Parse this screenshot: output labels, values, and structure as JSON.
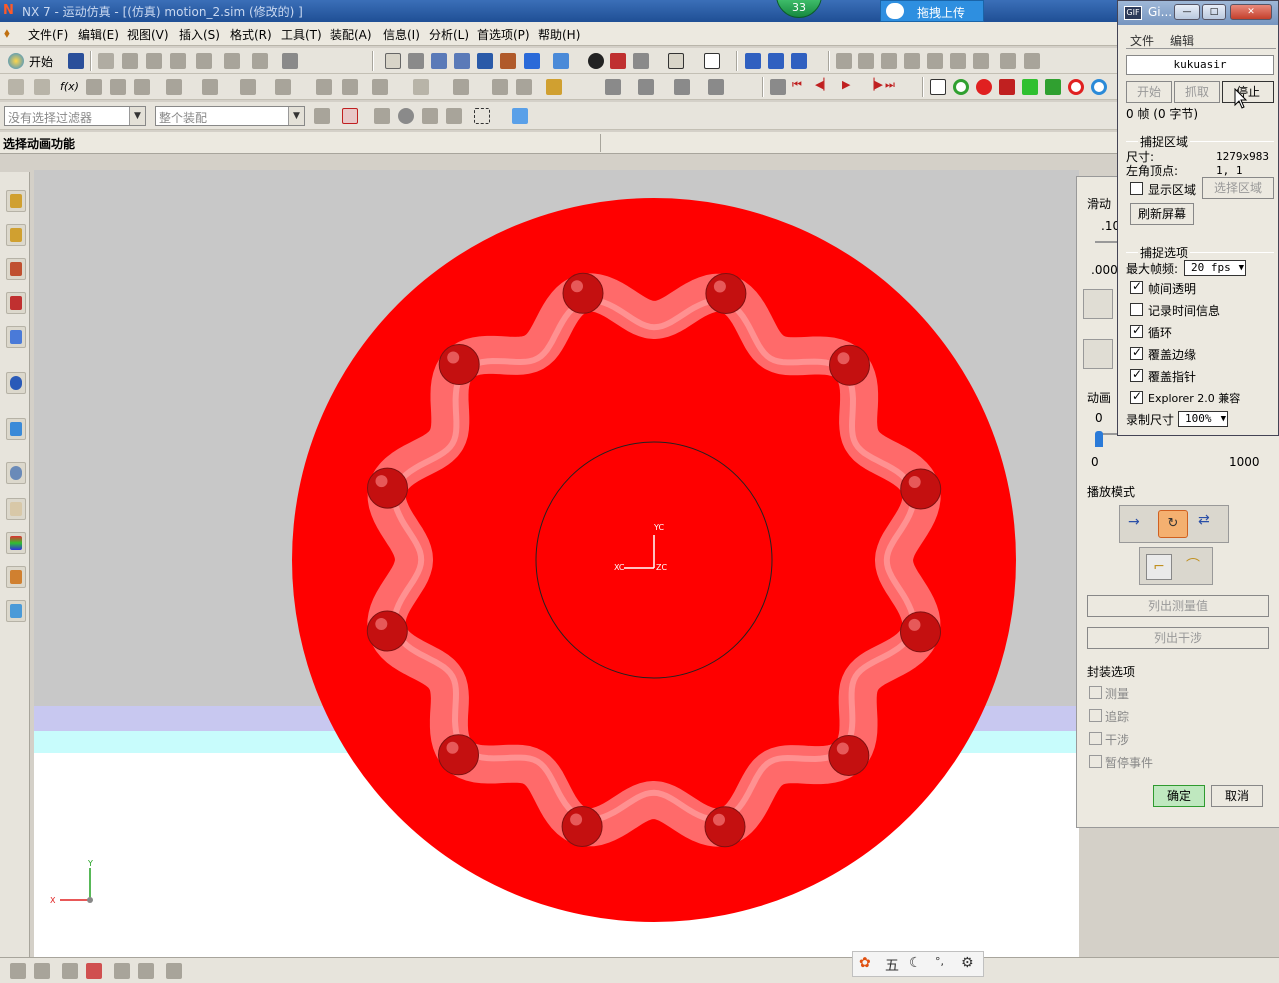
{
  "window": {
    "title": "NX 7 - 运动仿真 - [(仿真) motion_2.sim (修改的) ]",
    "badge_count": "33",
    "upload_label": "拖拽上传"
  },
  "menubar": {
    "items": [
      "文件(F)",
      "编辑(E)",
      "视图(V)",
      "插入(S)",
      "格式(R)",
      "工具(T)",
      "装配(A)",
      "信息(I)",
      "分析(L)",
      "首选项(P)",
      "帮助(H)"
    ]
  },
  "toolbar": {
    "start_label": "开始"
  },
  "filters": {
    "selection_filter": "没有选择过滤器",
    "assembly_scope": "整个装配"
  },
  "cue_line": "选择动画功能",
  "viewport": {
    "triad_top": {
      "x": "XC",
      "y": "YC",
      "z": "ZC"
    },
    "triad_bottom": {
      "x": "X",
      "y": "Y"
    }
  },
  "animation_panel": {
    "slider_label": "滑动",
    "slider_val1": ".10",
    "slider_val2": ".000",
    "anim_label": "动画",
    "anim_slider_min_top": "0",
    "anim_range_min": "0",
    "anim_range_max": "1000",
    "playback_mode_label": "播放模式",
    "list_measurements": "列出测量值",
    "list_interference": "列出干涉",
    "package_options_label": "封装选项",
    "package_options": [
      {
        "label": "测量",
        "checked": false
      },
      {
        "label": "追踪",
        "checked": false
      },
      {
        "label": "干涉",
        "checked": false
      },
      {
        "label": "暂停事件",
        "checked": false
      }
    ],
    "ok_label": "确定",
    "cancel_label": "取消"
  },
  "gif_recorder": {
    "title": "Gi...",
    "menu": [
      "文件",
      "编辑"
    ],
    "author": "kukuasir",
    "start_label": "开始",
    "capture_label": "抓取",
    "stop_label": "停止",
    "frame_info": "0 帧 (0 字节)",
    "capture_area_label": "捕捉区域",
    "size_label": "尺寸:",
    "size_value": "1279x983",
    "origin_label": "左角顶点:",
    "origin_value": "1, 1",
    "show_area_label": "显示区域",
    "show_area_checked": false,
    "select_area_label": "选择区域",
    "refresh_label": "刷新屏幕",
    "capture_options_label": "捕捉选项",
    "max_fps_label": "最大帧频:",
    "max_fps_value": "20 fps",
    "options": [
      {
        "label": "帧间透明",
        "checked": true
      },
      {
        "label": "记录时间信息",
        "checked": false
      },
      {
        "label": "循环",
        "checked": true
      },
      {
        "label": "覆盖边缘",
        "checked": true
      },
      {
        "label": "覆盖指针",
        "checked": true
      },
      {
        "label": "Explorer 2.0 兼容",
        "checked": true
      }
    ],
    "record_size_label": "录制尺寸",
    "record_size_value": "100%"
  },
  "ime_bar": {
    "label": "五"
  },
  "colors": {
    "part_red": "#ff0000",
    "ball_red": "#c41010",
    "groove": "#ff6a6a",
    "viewport_bg": "#c8c8c8",
    "accent_ok": "#2f9a2f"
  }
}
